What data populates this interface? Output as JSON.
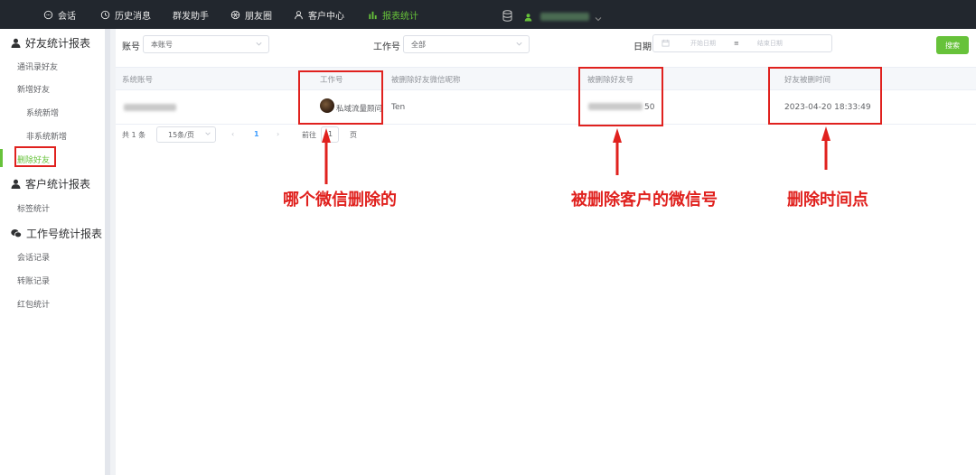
{
  "nav": {
    "items": [
      {
        "label": "会话",
        "icon": "chat-bubble-icon"
      },
      {
        "label": "历史消息",
        "icon": "clock-icon"
      },
      {
        "label": "群发助手",
        "icon": ""
      },
      {
        "label": "朋友圈",
        "icon": "aperture-icon"
      },
      {
        "label": "客户中心",
        "icon": "user-icon"
      },
      {
        "label": "报表统计",
        "icon": "bar-chart-icon",
        "active": true
      }
    ],
    "accent": "#67c23a"
  },
  "sidebar": {
    "groups": [
      {
        "label": "好友统计报表",
        "icon": "user-icon"
      },
      {
        "label": "客户统计报表",
        "icon": "user-icon"
      },
      {
        "label": "工作号统计报表",
        "icon": "wechat-icon"
      }
    ],
    "items": {
      "address_book": "通讯录好友",
      "new_friends": "新增好友",
      "system_new": "系统新增",
      "non_system_new": "非系统新增",
      "deleted_friends": "删除好友",
      "tag_stats": "标签统计",
      "chat_records": "会话记录",
      "transfer_records": "转账记录",
      "red_packet_stats": "红包统计"
    }
  },
  "filters": {
    "account_label": "账号",
    "account_value": "本账号",
    "worker_label": "工作号",
    "worker_value": "全部",
    "date_label": "日期",
    "start_placeholder": "开始日期",
    "end_placeholder": "结束日期",
    "search_button": "搜索"
  },
  "table": {
    "headers": {
      "system_account": "系统账号",
      "worker_id": "工作号",
      "deleted_nickname": "被删除好友微信昵称",
      "deleted_wechat_id": "被删除好友号",
      "deleted_time": "好友被删时间"
    },
    "row": {
      "worker_name": "私域流量顾问",
      "nickname": "Ten",
      "wechat_id_suffix": "50",
      "time": "2023-04-20 18:33:49"
    }
  },
  "pagination": {
    "total": "共 1 条",
    "page_size": "15条/页",
    "prev": "‹",
    "current": "1",
    "next": "›",
    "goto_label": "前往",
    "goto_value": "1",
    "page_suffix": "页"
  },
  "annotations": {
    "who_deleted": "哪个微信删除的",
    "customer_wechat": "被删除客户的微信号",
    "delete_time": "删除时间点",
    "color": "#e0211e"
  }
}
